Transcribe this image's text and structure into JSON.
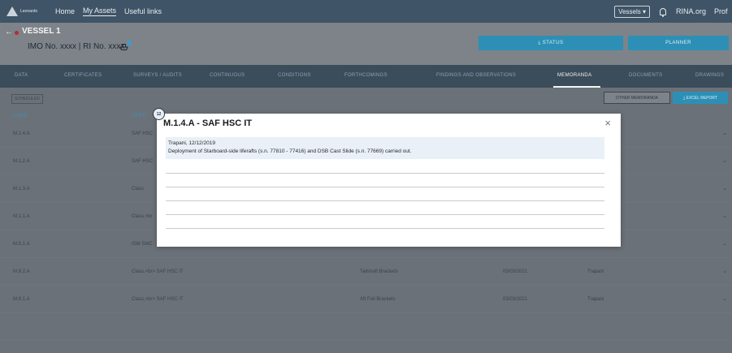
{
  "topbar": {
    "logo_line1": "Leonardo",
    "logo_line2": "",
    "nav": [
      "Home",
      "My Assets",
      "Useful links"
    ],
    "active_nav": "My Assets",
    "vessels_label": "Vessels ▾",
    "rina_label": "RINA.org",
    "profile_label": "Prof"
  },
  "vessel": {
    "title": "VESSEL 1",
    "imo": "IMO No. xxxx      | RI No. xxxx"
  },
  "actions": {
    "status_label": "⤓  STATUS",
    "planner_label": "PLANNER"
  },
  "tabs": [
    "DATA",
    "CERTIFICATES",
    "SURVEYS / AUDITS",
    "CONTINUOUS",
    "CONDITIONS",
    "FORTHCOMINGS",
    "FINDINGS AND OBSERVATIONS",
    "MEMORANDA",
    "DOCUMENTS",
    "DRAWINGS"
  ],
  "active_tab": "MEMORANDA",
  "toolbar": {
    "scheduled_label": "SCHEDULED",
    "other_label": "OTHER MEMORANDA",
    "excel_label": "⤓  EXCEL REPORT"
  },
  "table": {
    "headers": {
      "code": "CODE",
      "cert": "CERTI"
    },
    "rows": [
      {
        "code": "M.1.4.A",
        "cert": "SAF HSC",
        "item": "",
        "date": "",
        "place": ""
      },
      {
        "code": "M.1.2.A",
        "cert": "SAF HSC",
        "item": "",
        "date": "",
        "place": ""
      },
      {
        "code": "M.1.3.A",
        "cert": "Class",
        "item": "",
        "date": "",
        "place": ""
      },
      {
        "code": "M.1.1.A",
        "cert": "Class,<br",
        "item": "",
        "date": "",
        "place": ""
      },
      {
        "code": "M.5.1.A",
        "cert": "ISM SMC",
        "item": "",
        "date": "",
        "place": ""
      },
      {
        "code": "M.9.2.A",
        "cert": "Class,<br> SAF HSC IT",
        "item": "Tailshaft Brackets",
        "date": "03/03/2021",
        "place": "Trapani"
      },
      {
        "code": "M.9.1.A",
        "cert": "Class,<br> SAF HSC IT",
        "item": "Aft Foil Brackets",
        "date": "03/03/2021",
        "place": "Trapani"
      }
    ]
  },
  "modal": {
    "title": "M.1.4.A - SAF HSC IT",
    "close": "×",
    "memo_place_date": "Trapani, 12/12/2019",
    "memo_text": "Deployment of Starboard-side liferafts (s.n. 77810 - 77416) and DSB Cast Slide (s.n. 77669) carried out."
  },
  "step_badge": "12"
}
